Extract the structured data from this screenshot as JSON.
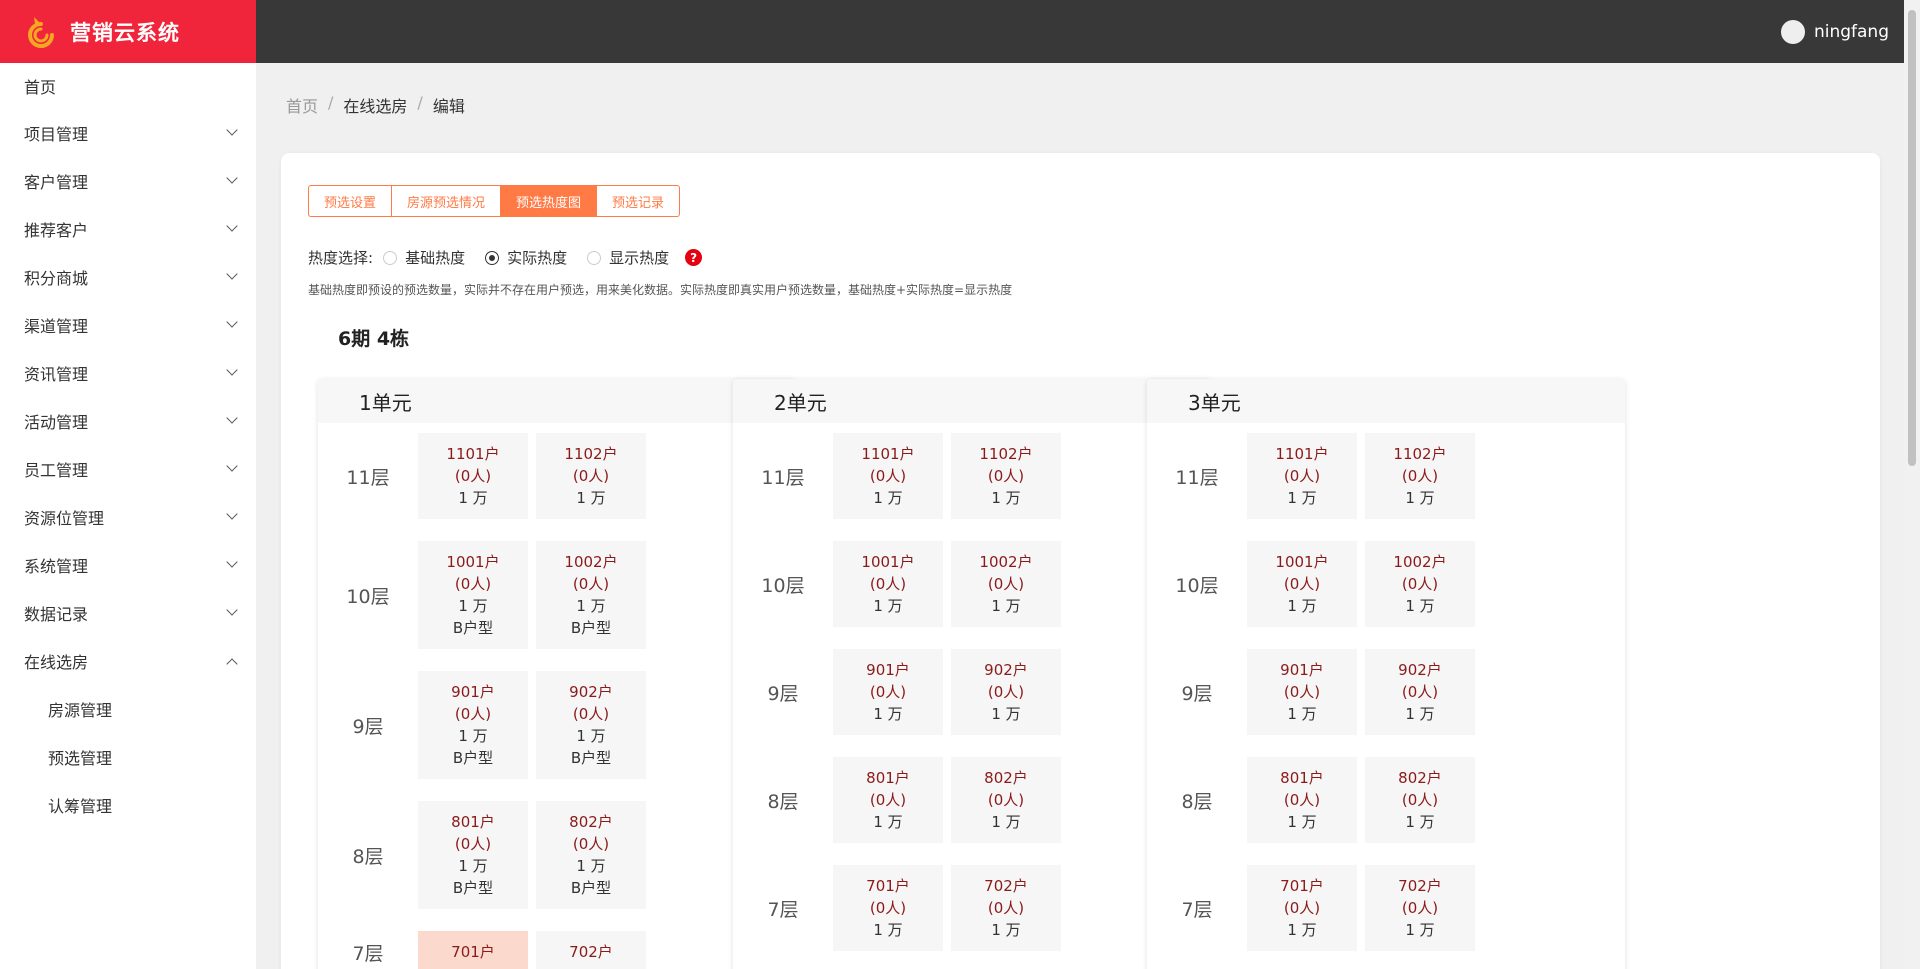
{
  "app": {
    "title": "营销云系统",
    "user": "ningfang"
  },
  "sidebar": {
    "items": [
      {
        "label": "首页",
        "expandable": false
      },
      {
        "label": "项目管理",
        "expandable": true
      },
      {
        "label": "客户管理",
        "expandable": true
      },
      {
        "label": "推荐客户",
        "expandable": true
      },
      {
        "label": "积分商城",
        "expandable": true
      },
      {
        "label": "渠道管理",
        "expandable": true
      },
      {
        "label": "资讯管理",
        "expandable": true
      },
      {
        "label": "活动管理",
        "expandable": true
      },
      {
        "label": "员工管理",
        "expandable": true
      },
      {
        "label": "资源位管理",
        "expandable": true
      },
      {
        "label": "系统管理",
        "expandable": true
      },
      {
        "label": "数据记录",
        "expandable": true
      },
      {
        "label": "在线选房",
        "expandable": true,
        "expanded": true
      }
    ],
    "subitems": [
      "房源管理",
      "预选管理",
      "认筹管理"
    ]
  },
  "breadcrumb": {
    "home": "首页",
    "sep": "/",
    "section": "在线选房",
    "current": "编辑"
  },
  "tabs": [
    "预选设置",
    "房源预选情况",
    "预选热度图",
    "预选记录"
  ],
  "active_tab": 2,
  "heat": {
    "label": "热度选择:",
    "options": [
      "基础热度",
      "实际热度",
      "显示热度"
    ],
    "selected": 1,
    "help": "?",
    "description": "基础热度即预设的预选数量，实际并不存在用户预选，用来美化数据。实际热度即真实用户预选数量，基础热度+实际热度=显示热度"
  },
  "building": "6期 4栋",
  "units": [
    {
      "name": "1单元",
      "floors": [
        {
          "label": "11层",
          "rooms": [
            {
              "no": "1101户",
              "count": "(0人)",
              "price": "1 万",
              "type": ""
            },
            {
              "no": "1102户",
              "count": "(0人)",
              "price": "1 万",
              "type": ""
            }
          ]
        },
        {
          "label": "10层",
          "rooms": [
            {
              "no": "1001户",
              "count": "(0人)",
              "price": "1 万",
              "type": "B户型"
            },
            {
              "no": "1002户",
              "count": "(0人)",
              "price": "1 万",
              "type": "B户型"
            }
          ]
        },
        {
          "label": "9层",
          "rooms": [
            {
              "no": "901户",
              "count": "(0人)",
              "price": "1 万",
              "type": "B户型"
            },
            {
              "no": "902户",
              "count": "(0人)",
              "price": "1 万",
              "type": "B户型"
            }
          ]
        },
        {
          "label": "8层",
          "rooms": [
            {
              "no": "801户",
              "count": "(0人)",
              "price": "1 万",
              "type": "B户型"
            },
            {
              "no": "802户",
              "count": "(0人)",
              "price": "1 万",
              "type": "B户型"
            }
          ]
        },
        {
          "label": "7层",
          "rooms": [
            {
              "no": "701户",
              "count": "",
              "price": "",
              "type": "",
              "hot": true
            },
            {
              "no": "702户",
              "count": "",
              "price": "",
              "type": ""
            }
          ]
        }
      ]
    },
    {
      "name": "2单元",
      "floors": [
        {
          "label": "11层",
          "rooms": [
            {
              "no": "1101户",
              "count": "(0人)",
              "price": "1 万",
              "type": ""
            },
            {
              "no": "1102户",
              "count": "(0人)",
              "price": "1 万",
              "type": ""
            }
          ]
        },
        {
          "label": "10层",
          "rooms": [
            {
              "no": "1001户",
              "count": "(0人)",
              "price": "1 万",
              "type": ""
            },
            {
              "no": "1002户",
              "count": "(0人)",
              "price": "1 万",
              "type": ""
            }
          ]
        },
        {
          "label": "9层",
          "rooms": [
            {
              "no": "901户",
              "count": "(0人)",
              "price": "1 万",
              "type": ""
            },
            {
              "no": "902户",
              "count": "(0人)",
              "price": "1 万",
              "type": ""
            }
          ]
        },
        {
          "label": "8层",
          "rooms": [
            {
              "no": "801户",
              "count": "(0人)",
              "price": "1 万",
              "type": ""
            },
            {
              "no": "802户",
              "count": "(0人)",
              "price": "1 万",
              "type": ""
            }
          ]
        },
        {
          "label": "7层",
          "rooms": [
            {
              "no": "701户",
              "count": "(0人)",
              "price": "1 万",
              "type": ""
            },
            {
              "no": "702户",
              "count": "(0人)",
              "price": "1 万",
              "type": ""
            }
          ]
        }
      ]
    },
    {
      "name": "3单元",
      "floors": [
        {
          "label": "11层",
          "rooms": [
            {
              "no": "1101户",
              "count": "(0人)",
              "price": "1 万",
              "type": ""
            },
            {
              "no": "1102户",
              "count": "(0人)",
              "price": "1 万",
              "type": ""
            }
          ]
        },
        {
          "label": "10层",
          "rooms": [
            {
              "no": "1001户",
              "count": "(0人)",
              "price": "1 万",
              "type": ""
            },
            {
              "no": "1002户",
              "count": "(0人)",
              "price": "1 万",
              "type": ""
            }
          ]
        },
        {
          "label": "9层",
          "rooms": [
            {
              "no": "901户",
              "count": "(0人)",
              "price": "1 万",
              "type": ""
            },
            {
              "no": "902户",
              "count": "(0人)",
              "price": "1 万",
              "type": ""
            }
          ]
        },
        {
          "label": "8层",
          "rooms": [
            {
              "no": "801户",
              "count": "(0人)",
              "price": "1 万",
              "type": ""
            },
            {
              "no": "802户",
              "count": "(0人)",
              "price": "1 万",
              "type": ""
            }
          ]
        },
        {
          "label": "7层",
          "rooms": [
            {
              "no": "701户",
              "count": "(0人)",
              "price": "1 万",
              "type": ""
            },
            {
              "no": "702户",
              "count": "(0人)",
              "price": "1 万",
              "type": ""
            }
          ]
        }
      ]
    }
  ],
  "colors": {
    "brand": "#f0243a",
    "header": "#383838",
    "accent": "#ff7a45",
    "room_text": "#8b1a1a",
    "hot_room": "#fbd9cd",
    "help": "#e60012"
  }
}
